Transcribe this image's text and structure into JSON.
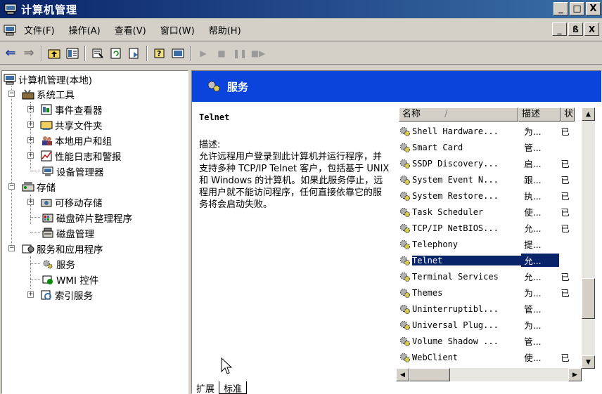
{
  "window": {
    "title": "计算机管理",
    "buttons": [
      "_",
      "□",
      "X"
    ]
  },
  "menu": {
    "items": [
      "文件(F)",
      "操作(A)",
      "查看(V)",
      "窗口(W)",
      "帮助(H)"
    ],
    "mdi_buttons": [
      "_",
      "ß",
      "X"
    ]
  },
  "toolbar": {
    "back_icon": "back-arrow-icon",
    "forward_icon": "forward-arrow-icon"
  },
  "tree": {
    "root": "计算机管理(本地)",
    "system_tools": "系统工具",
    "event_viewer": "事件查看器",
    "shared_folders": "共享文件夹",
    "local_users": "本地用户和组",
    "perf_logs": "性能日志和警报",
    "device_manager": "设备管理器",
    "storage": "存储",
    "removable_storage": "可移动存储",
    "defrag": "磁盘碎片整理程序",
    "disk_mgmt": "磁盘管理",
    "services_apps": "服务和应用程序",
    "services": "服务",
    "wmi": "WMI 控件",
    "indexing": "索引服务"
  },
  "header": {
    "title": "服务"
  },
  "description": {
    "service_name": "Telnet",
    "label": "描述:",
    "text": "允许远程用户登录到此计算机并运行程序，并支持多种 TCP/IP Telnet 客户，包括基于 UNIX 和 Windows 的计算机。如果此服务停止，远程用户就不能访问程序，任何直接依靠它的服务将会启动失败。"
  },
  "list": {
    "columns": {
      "name": "名称",
      "sort": "/",
      "desc": "描述",
      "status": "状"
    },
    "rows": [
      {
        "name": "Shell Hardware...",
        "desc": "为...",
        "status": "已"
      },
      {
        "name": "Smart Card",
        "desc": "管...",
        "status": ""
      },
      {
        "name": "SSDP Discovery...",
        "desc": "启...",
        "status": "已"
      },
      {
        "name": "System Event N...",
        "desc": "跟...",
        "status": "已"
      },
      {
        "name": "System Restore...",
        "desc": "执...",
        "status": "已"
      },
      {
        "name": "Task Scheduler",
        "desc": "使...",
        "status": "已"
      },
      {
        "name": "TCP/IP NetBIOS...",
        "desc": "允...",
        "status": "已"
      },
      {
        "name": "Telephony",
        "desc": "提...",
        "status": ""
      },
      {
        "name": "Telnet",
        "desc": "允...",
        "status": "",
        "selected": true
      },
      {
        "name": "Terminal Services",
        "desc": "允...",
        "status": "已"
      },
      {
        "name": "Themes",
        "desc": "为...",
        "status": "已"
      },
      {
        "name": "Uninterruptibl...",
        "desc": "管...",
        "status": ""
      },
      {
        "name": "Universal Plug...",
        "desc": "为...",
        "status": ""
      },
      {
        "name": "Volume Shadow ...",
        "desc": "管...",
        "status": ""
      },
      {
        "name": "WebClient",
        "desc": "使...",
        "status": "已"
      }
    ]
  },
  "tabs": [
    "扩展",
    "标准"
  ]
}
